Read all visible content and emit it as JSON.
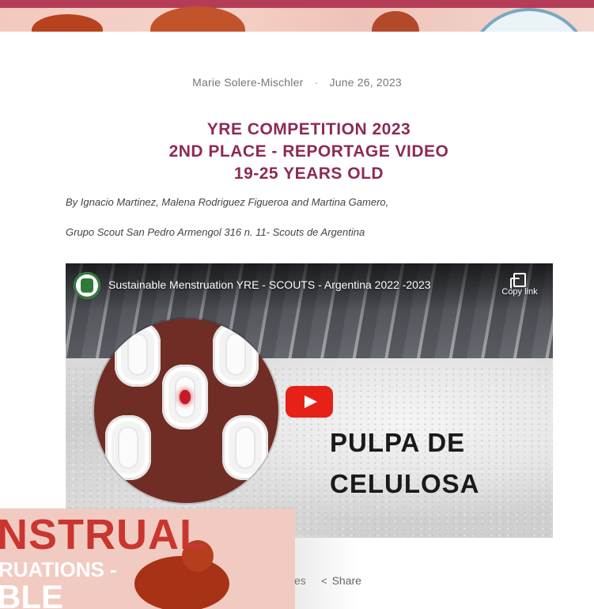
{
  "post": {
    "author": "Marie Solere-Mischler",
    "separator": "·",
    "date": "June 26, 2023",
    "title_lines": [
      "YRE COMPETITION 2023",
      "2ND PLACE - REPORTAGE VIDEO",
      "19-25 YEARS OLD"
    ],
    "byline_1": "By Ignacio Martinez, Malena Rodriguez Figueroa and Martina Gamero,",
    "byline_2": "Grupo Scout San Pedro Armengol 316 n. 11- Scouts de Argentina"
  },
  "video": {
    "title": "Sustainable Menstruation YRE - SCOUTS - Argentina 2022 -2023",
    "copy_link_label": "Copy link",
    "overlay_line_1": "PULPA DE",
    "overlay_line_2": "CELULOSA",
    "play_icon": "youtube-play-icon"
  },
  "thumbnail": {
    "line_1": "NSTRUAL",
    "line_2": "RUATIONS -",
    "line_3": "BLE"
  },
  "actions": {
    "partial_label": "es",
    "share_label": "Share",
    "share_icon": "share-icon"
  },
  "colors": {
    "title": "#8d2a55",
    "accent_bar": "#b53c57",
    "youtube_red": "#e62117",
    "thumbnail_bg": "#f1cbc1"
  }
}
